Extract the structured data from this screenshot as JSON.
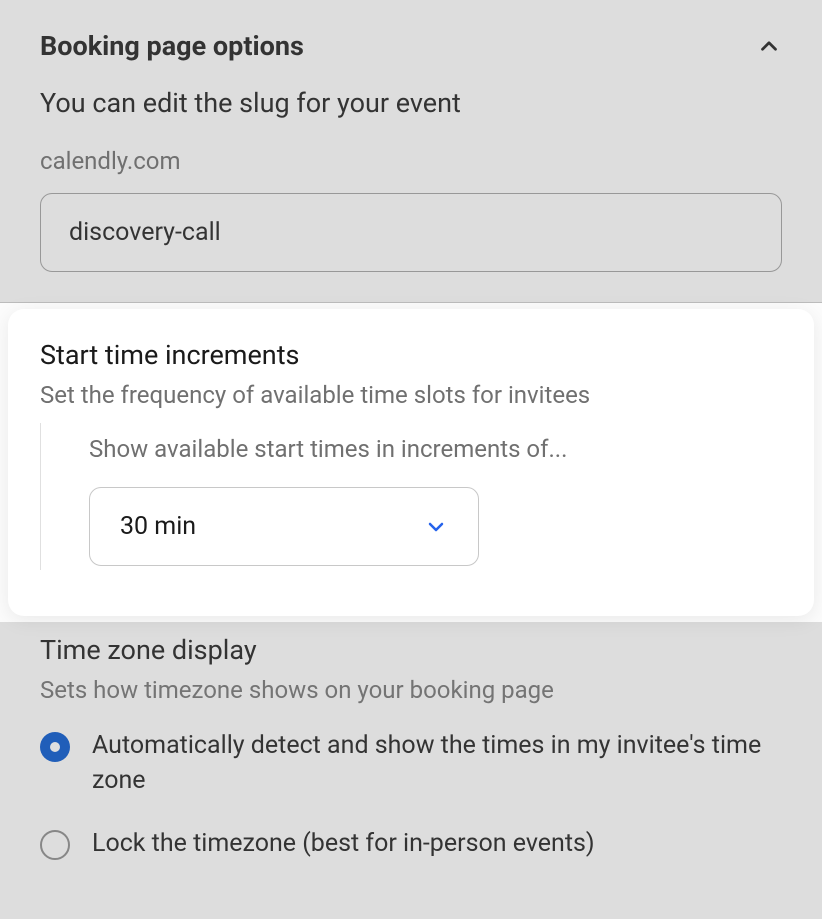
{
  "booking": {
    "section_title": "Booking page options",
    "slug_intro": "You can edit the slug for your event",
    "slug_domain": "calendly.com",
    "slug_value": "discovery-call"
  },
  "increments": {
    "title": "Start time increments",
    "subtitle": "Set the frequency of available time slots for invitees",
    "label": "Show available start times in increments of...",
    "value": "30 min"
  },
  "timezone": {
    "title": "Time zone display",
    "subtitle": "Sets how timezone shows on your booking page",
    "options": [
      "Automatically detect and show the times in my invitee's time zone",
      "Lock the timezone (best for in-person events)"
    ]
  }
}
